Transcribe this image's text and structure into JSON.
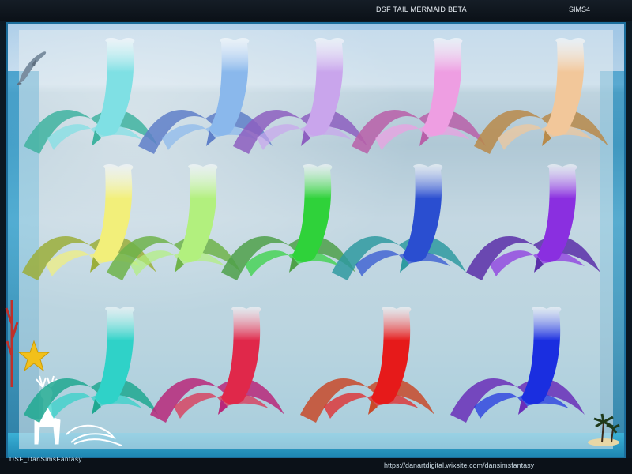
{
  "header": {
    "title": "DSF TAIL MERMAID BETA",
    "game": "SIMS4"
  },
  "footer": {
    "credit": "DSF_DanSimsFantasy",
    "url": "https://danartdigital.wixsite.com/dansimsfantasy"
  },
  "tails": [
    {
      "name": "tail-aqua",
      "color": "#7fe0e4",
      "fin": "#3fb3a0"
    },
    {
      "name": "tail-sky-blue",
      "color": "#8ab8ec",
      "fin": "#5f7fc8"
    },
    {
      "name": "tail-lavender",
      "color": "#c9a5ec",
      "fin": "#8d5fc0"
    },
    {
      "name": "tail-pink",
      "color": "#ee9ee2",
      "fin": "#b85fa8"
    },
    {
      "name": "tail-peach",
      "color": "#f2c79a",
      "fin": "#b88a4a"
    },
    {
      "name": "tail-yellow",
      "color": "#f2ef7a",
      "fin": "#9bae3a"
    },
    {
      "name": "tail-lime",
      "color": "#b2f07e",
      "fin": "#6fb34a"
    },
    {
      "name": "tail-green",
      "color": "#2fd23a",
      "fin": "#4fa04a"
    },
    {
      "name": "tail-royal-blue",
      "color": "#2a4ed0",
      "fin": "#2f9aa0"
    },
    {
      "name": "tail-violet",
      "color": "#8a2fe0",
      "fin": "#5a2fa8"
    },
    {
      "name": "tail-teal",
      "color": "#2fd2c8",
      "fin": "#1fa890"
    },
    {
      "name": "tail-crimson",
      "color": "#e0284a",
      "fin": "#b8287a"
    },
    {
      "name": "tail-red",
      "color": "#e61a1a",
      "fin": "#c84a2a"
    },
    {
      "name": "tail-blue",
      "color": "#1a2ee0",
      "fin": "#6a2fb8"
    }
  ]
}
